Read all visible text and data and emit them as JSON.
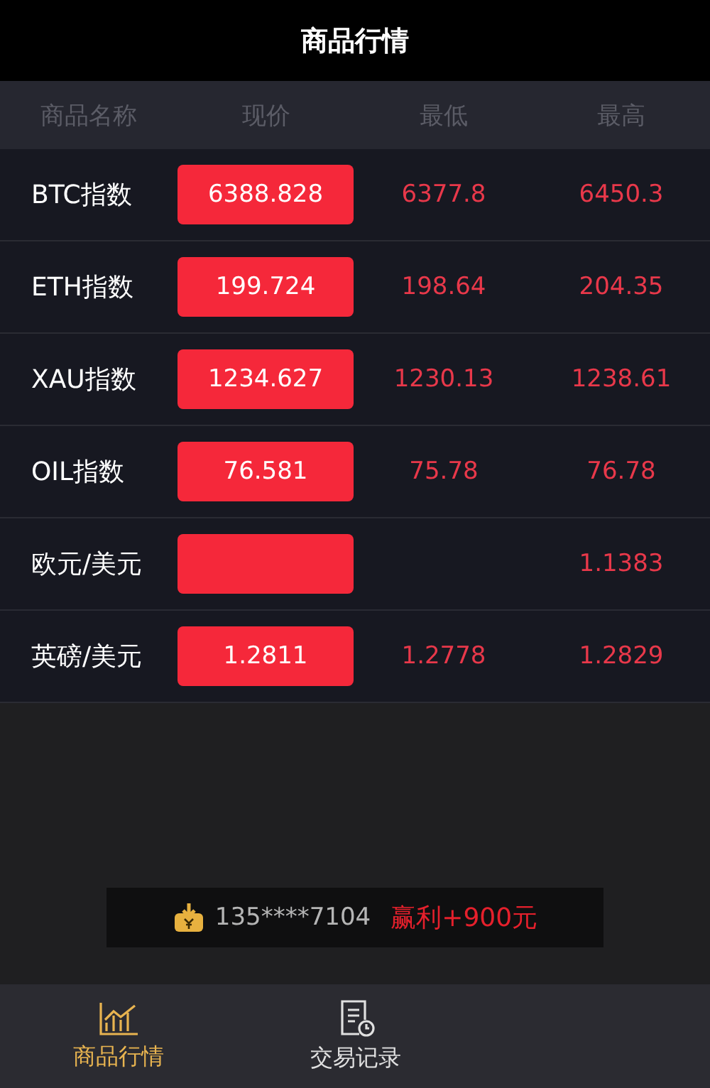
{
  "title": "商品行情",
  "columns": [
    "商品名称",
    "现价",
    "最低",
    "最高"
  ],
  "rows": [
    {
      "name": "BTC指数",
      "price": "6388.828",
      "low": "6377.8",
      "high": "6450.3"
    },
    {
      "name": "ETH指数",
      "price": "199.724",
      "low": "198.64",
      "high": "204.35"
    },
    {
      "name": "XAU指数",
      "price": "1234.627",
      "low": "1230.13",
      "high": "1238.61"
    },
    {
      "name": "OIL指数",
      "price": "76.581",
      "low": "75.78",
      "high": "76.78"
    },
    {
      "name": "欧元/美元",
      "high": "1.1383"
    },
    {
      "name": "英磅/美元",
      "price": "1.2811",
      "low": "1.2778",
      "high": "1.2829"
    }
  ],
  "ticker": {
    "phone": "135****7104",
    "profit": "赢利+900元"
  },
  "tabs": [
    {
      "label": "商品行情",
      "selected": true,
      "kind": "chart"
    },
    {
      "label": "交易记录",
      "selected": false,
      "kind": "record"
    }
  ]
}
